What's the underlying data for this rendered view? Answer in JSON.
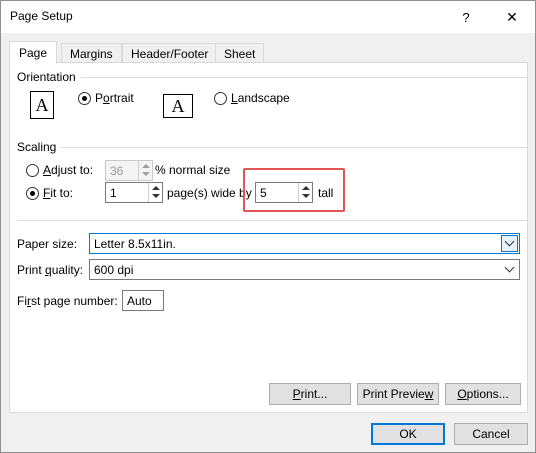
{
  "window": {
    "title": "Page Setup",
    "help_glyph": "?",
    "close_glyph": "✕"
  },
  "tabs": [
    {
      "label": "Page"
    },
    {
      "label": "Margins"
    },
    {
      "label": "Header/Footer"
    },
    {
      "label": "Sheet"
    }
  ],
  "orientation": {
    "heading": "Orientation",
    "portrait": {
      "pre": "P",
      "ul": "o",
      "post": "rtrait",
      "selected": true
    },
    "landscape": {
      "pre": "",
      "ul": "L",
      "post": "andscape",
      "selected": false
    },
    "icon_glyph": "A"
  },
  "scaling": {
    "heading": "Scaling",
    "adjust": {
      "pre": "",
      "ul": "A",
      "post": "djust to:",
      "value": "36",
      "suffix": "% normal size",
      "selected": false
    },
    "fit": {
      "pre": "",
      "ul": "F",
      "post": "it to:",
      "wide_value": "1",
      "wide_label": "page(s) wide by",
      "tall_value": "5",
      "tall_label": "tall",
      "selected": true
    }
  },
  "paper_size": {
    "label": "Paper size:",
    "value": "Letter 8.5x11in."
  },
  "print_quality": {
    "pre": "Print ",
    "ul": "q",
    "post": "uality:",
    "value": "600 dpi"
  },
  "first_page": {
    "pre": "Fi",
    "ul": "r",
    "post": "st page number:",
    "value": "Auto"
  },
  "buttons": {
    "print": {
      "pre": "",
      "ul": "P",
      "post": "rint..."
    },
    "preview": {
      "pre": "Print Previe",
      "ul": "w",
      "post": ""
    },
    "options": {
      "pre": "",
      "ul": "O",
      "post": "ptions..."
    },
    "ok": "OK",
    "cancel": "Cancel"
  },
  "colors": {
    "accent": "#0078d7",
    "highlight": "#e05555"
  }
}
